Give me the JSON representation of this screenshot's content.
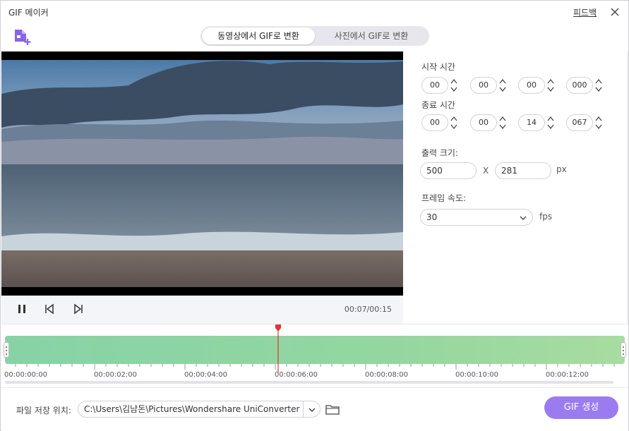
{
  "window": {
    "title": "GIF 메이커",
    "feedback_label": "피드백"
  },
  "tabs": [
    {
      "label": "동영상에서 GIF로 변환",
      "active": true
    },
    {
      "label": "사진에서 GIF로 변환",
      "active": false
    }
  ],
  "player": {
    "time": "00:07/00:15"
  },
  "settings": {
    "start_label": "시작 시간",
    "start": [
      "00",
      "00",
      "00",
      "000"
    ],
    "end_label": "종료 시간",
    "end": [
      "00",
      "00",
      "14",
      "067"
    ],
    "size_label": "출력 크기:",
    "width": "500",
    "height": "281",
    "x_sep": "X",
    "size_unit": "px",
    "fps_label": "프레임 속도:",
    "fps_value": "30",
    "fps_unit": "fps"
  },
  "timeline": {
    "labels": [
      "00:00:00:00",
      "00:00:02:00",
      "00:00:04:00",
      "00:00:06:00",
      "00:00:08:00",
      "00:00:10:00",
      "00:00:12:00"
    ],
    "playhead_fraction": 0.44
  },
  "bottom": {
    "save_label": "파일 저장 위치:",
    "path": "C:\\Users\\김남돈\\Pictures\\Wondershare UniConverter",
    "generate_label": "GIF 생성"
  },
  "colors": {
    "accent": "#9b7cf0",
    "playhead": "#e03535",
    "strip": "#8fd4a3"
  }
}
